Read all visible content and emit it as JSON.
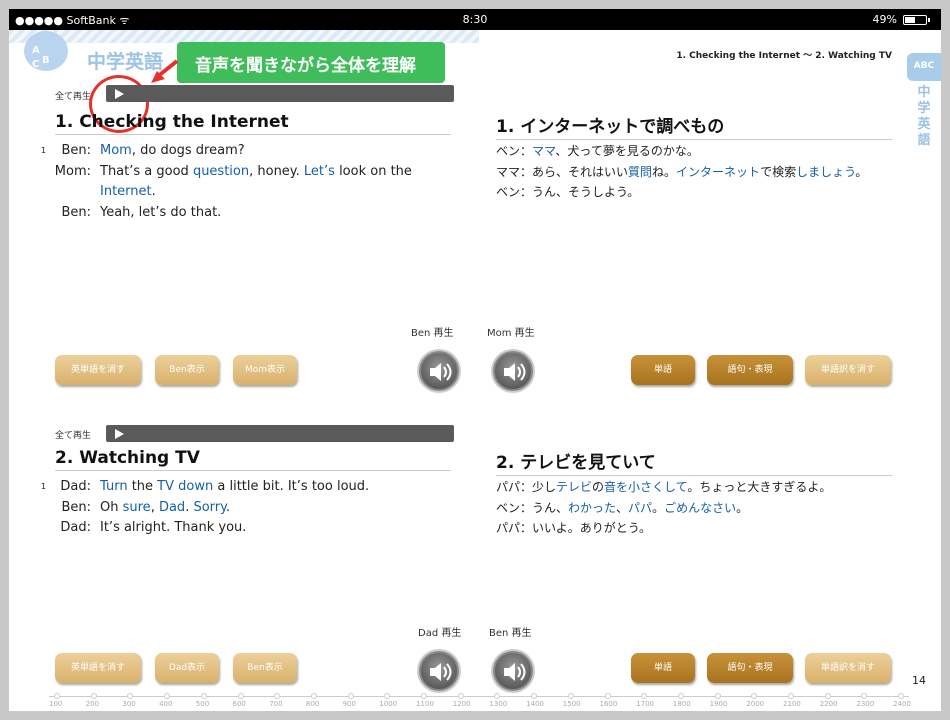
{
  "status": {
    "carrier": "●●●●● SoftBank ᯤ",
    "time": "8:30",
    "battery": "49%"
  },
  "header": {
    "logo": "中学英語",
    "callout": "音声を聞きながら全体を理解",
    "breadcrumb": "1. Checking the Internet ～ 2. Watching TV",
    "side_label": "中学英語"
  },
  "section1": {
    "play_label": "全て再生",
    "title_en": "1. Checking the Internet",
    "title_jp": "1. インターネットで調べもの",
    "line_number": "1",
    "dialogue": [
      {
        "speaker": "Ben:",
        "parts": [
          [
            "Mom",
            true
          ],
          [
            ", do dogs dream?",
            false
          ]
        ]
      },
      {
        "speaker": "Mom:",
        "parts": [
          [
            "That’s a good ",
            false
          ],
          [
            "question",
            true
          ],
          [
            ", honey.  ",
            false
          ],
          [
            "Let’s",
            true
          ],
          [
            " look on the",
            false
          ]
        ]
      },
      {
        "speaker": "",
        "parts": [
          [
            "Internet",
            true
          ],
          [
            ".",
            false
          ]
        ]
      },
      {
        "speaker": "Ben:",
        "parts": [
          [
            "Yeah, let’s do that.",
            false
          ]
        ]
      }
    ],
    "japanese": [
      [
        [
          "ベン：",
          false
        ],
        [
          "ママ",
          true
        ],
        [
          "、犬って夢を見るのかな。",
          false
        ]
      ],
      [
        [
          "ママ：あら、それはいい",
          false
        ],
        [
          "質問",
          true
        ],
        [
          "ね。",
          false
        ],
        [
          "インターネット",
          true
        ],
        [
          "で検索",
          false
        ],
        [
          "しましょう",
          true
        ],
        [
          "。",
          false
        ]
      ],
      [
        [
          "ベン：うん、そうしよう。",
          false
        ]
      ]
    ],
    "speaker1_label": "Ben 再生",
    "speaker2_label": "Mom 再生",
    "buttons_left": [
      "英単語を消す",
      "Ben表示",
      "Mom表示"
    ],
    "buttons_right": [
      "単語",
      "語句・表現",
      "単語訳を消す"
    ]
  },
  "section2": {
    "play_label": "全て再生",
    "title_en": "2. Watching TV",
    "title_jp": "2. テレビを見ていて",
    "line_number": "1",
    "dialogue": [
      {
        "speaker": "Dad:",
        "parts": [
          [
            "Turn",
            true
          ],
          [
            " the ",
            false
          ],
          [
            "TV",
            true
          ],
          [
            " ",
            false
          ],
          [
            "down",
            true
          ],
          [
            " a little bit.  It’s too loud.",
            false
          ]
        ]
      },
      {
        "speaker": "Ben:",
        "parts": [
          [
            "Oh ",
            false
          ],
          [
            "sure",
            true
          ],
          [
            ", ",
            false
          ],
          [
            "Dad",
            true
          ],
          [
            ".  ",
            false
          ],
          [
            "Sorry",
            true
          ],
          [
            ".",
            false
          ]
        ]
      },
      {
        "speaker": "Dad:",
        "parts": [
          [
            "It’s alright.  Thank you.",
            false
          ]
        ]
      }
    ],
    "japanese": [
      [
        [
          "パパ：少し",
          false
        ],
        [
          "テレビ",
          true
        ],
        [
          "の",
          false
        ],
        [
          "音を小さくして",
          true
        ],
        [
          "。ちょっと大きすぎるよ。",
          false
        ]
      ],
      [
        [
          "ベン：うん、",
          false
        ],
        [
          "わかった",
          true
        ],
        [
          "、",
          false
        ],
        [
          "パパ",
          true
        ],
        [
          "。",
          false
        ],
        [
          "ごめんなさい",
          true
        ],
        [
          "。",
          false
        ]
      ],
      [
        [
          "パパ：いいよ。ありがとう。",
          false
        ]
      ]
    ],
    "speaker1_label": "Dad 再生",
    "speaker2_label": "Ben 再生",
    "buttons_left": [
      "英単語を消す",
      "Dad表示",
      "Ben表示"
    ],
    "buttons_right": [
      "単語",
      "語句・表現",
      "単語訳を消す"
    ]
  },
  "page_number": "14",
  "ruler": [
    "100",
    "200",
    "300",
    "400",
    "500",
    "600",
    "700",
    "800",
    "900",
    "1000",
    "1100",
    "1200",
    "1300",
    "1400",
    "1500",
    "1600",
    "1700",
    "1800",
    "1900",
    "2000",
    "2100",
    "2200",
    "2300",
    "2400"
  ]
}
